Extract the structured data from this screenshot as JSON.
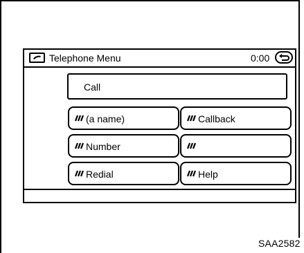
{
  "header": {
    "icon": "phone-icon",
    "title": "Telephone Menu",
    "clock": "0:00",
    "back_icon": "back-arrow-icon"
  },
  "call_field": {
    "label": "Call"
  },
  "menu_buttons": [
    {
      "label": "(a name)",
      "icon": "voice-command-icon"
    },
    {
      "label": "Callback",
      "icon": "voice-command-icon"
    },
    {
      "label": "Number",
      "icon": "voice-command-icon"
    },
    {
      "label": "",
      "icon": "voice-command-icon"
    },
    {
      "label": "Redial",
      "icon": "voice-command-icon"
    },
    {
      "label": "Help",
      "icon": "voice-command-icon"
    }
  ],
  "footer": {
    "code": "SAA2582"
  }
}
